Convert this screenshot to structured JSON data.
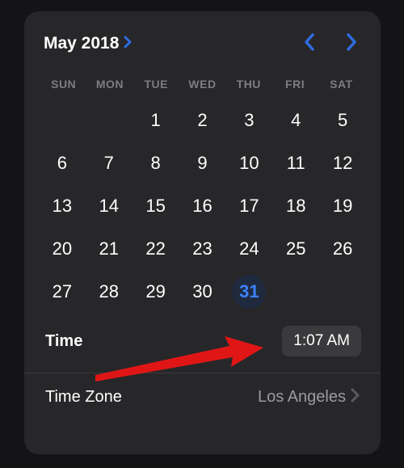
{
  "header": {
    "month_label": "May 2018"
  },
  "weekdays": [
    "SUN",
    "MON",
    "TUE",
    "WED",
    "THU",
    "FRI",
    "SAT"
  ],
  "calendar": {
    "leading_blanks": 2,
    "days": [
      1,
      2,
      3,
      4,
      5,
      6,
      7,
      8,
      9,
      10,
      11,
      12,
      13,
      14,
      15,
      16,
      17,
      18,
      19,
      20,
      21,
      22,
      23,
      24,
      25,
      26,
      27,
      28,
      29,
      30,
      31
    ],
    "selected_day": 31
  },
  "time": {
    "label": "Time",
    "value": "1:07 AM"
  },
  "timezone": {
    "label": "Time Zone",
    "value": "Los Angeles"
  }
}
